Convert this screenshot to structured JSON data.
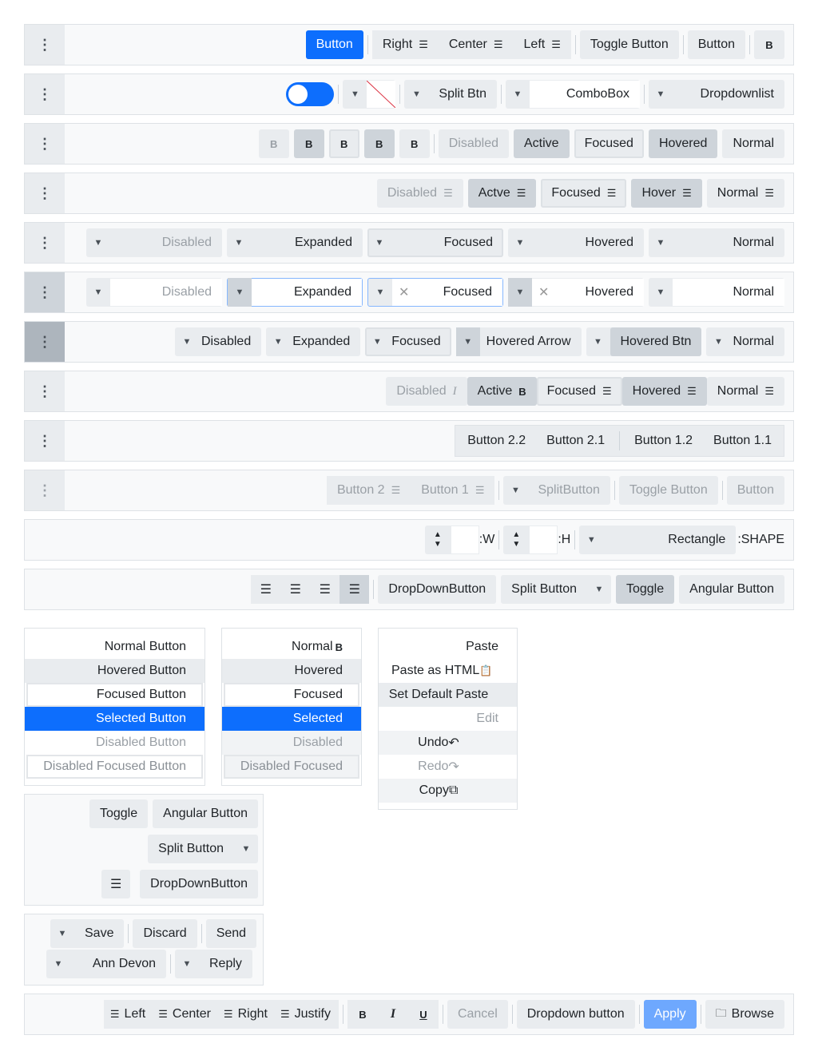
{
  "menu_icon": "⋮",
  "row1": {
    "button": "Button",
    "align": [
      "Right",
      "Center",
      "Left"
    ],
    "toggle": "Toggle Button",
    "button2": "Button",
    "bold": "B"
  },
  "row2": {
    "split": "Split Btn",
    "combo": "ComboBox",
    "ddl": "Dropdownlist"
  },
  "row3": {
    "bolds": [
      "B",
      "B",
      "B",
      "B",
      "B"
    ],
    "states": [
      "Disabled",
      "Active",
      "Focused",
      "Hovered",
      "Normal"
    ]
  },
  "row4": {
    "states": [
      "Disabled",
      "Actve",
      "Focused",
      "Hover",
      "Normal"
    ]
  },
  "row5": {
    "states": [
      "Disabled",
      "Expanded",
      "Focused",
      "Hovered",
      "Normal"
    ]
  },
  "row6": {
    "states": [
      "Disabled",
      "Expanded",
      "Focused",
      "Hovered",
      "Normal"
    ],
    "clear": "✕"
  },
  "row7": {
    "states": [
      "Disabled",
      "Expanded",
      "Focused",
      "Hovered Arrow",
      "Hovered Btn",
      "Normal"
    ]
  },
  "row8": {
    "states": [
      "Disabled",
      "Active",
      "Focused",
      "Hovered",
      "Normal"
    ],
    "italic": "I",
    "bold": "B"
  },
  "row9": {
    "buttons": [
      "Button 2.2",
      "Button 2.1",
      "Button 1.2",
      "Button 1.1"
    ]
  },
  "row10": {
    "b2": "Button 2",
    "b1": "Button 1",
    "split": "SplitButton",
    "toggle": "Toggle Button",
    "button": "Button"
  },
  "row11": {
    "w": ":W",
    "h": ":H",
    "shape": "Rectangle",
    "shape_label": ":SHAPE"
  },
  "row12": {
    "dropdown": "DropDownButton",
    "split": "Split Button",
    "toggle": "Toggle",
    "angular": "Angular Button"
  },
  "list1": [
    "Normal Button",
    "Hovered Button",
    "Focused Button",
    "Selected Button",
    "Disabled Button",
    "Disabled Focused Button"
  ],
  "list2": [
    "Normal",
    "Hovered",
    "Focused",
    "Selected",
    "Disabled",
    "Disabled Focused"
  ],
  "list3": [
    "Paste",
    "Paste as HTML",
    "Set Default Paste",
    "Edit",
    "Undo",
    "Redo",
    "Copy"
  ],
  "vbox": {
    "toggle": "Toggle",
    "angular": "Angular Button",
    "split": "Split Button",
    "dropdown": "DropDownButton"
  },
  "mail": {
    "save": "Save",
    "discard": "Discard",
    "send": "Send",
    "person": "Ann Devon",
    "reply": "Reply"
  },
  "bottom": {
    "align": [
      "Left",
      "Center",
      "Right",
      "Justify"
    ],
    "b": "B",
    "i": "I",
    "u": "U",
    "cancel": "Cancel",
    "dropdown": "Dropdown button",
    "apply": "Apply",
    "browse": "Browse"
  },
  "colors": {
    "accent": "#0d6efd",
    "surface": "#e9ecef",
    "active": "#ced4da"
  }
}
